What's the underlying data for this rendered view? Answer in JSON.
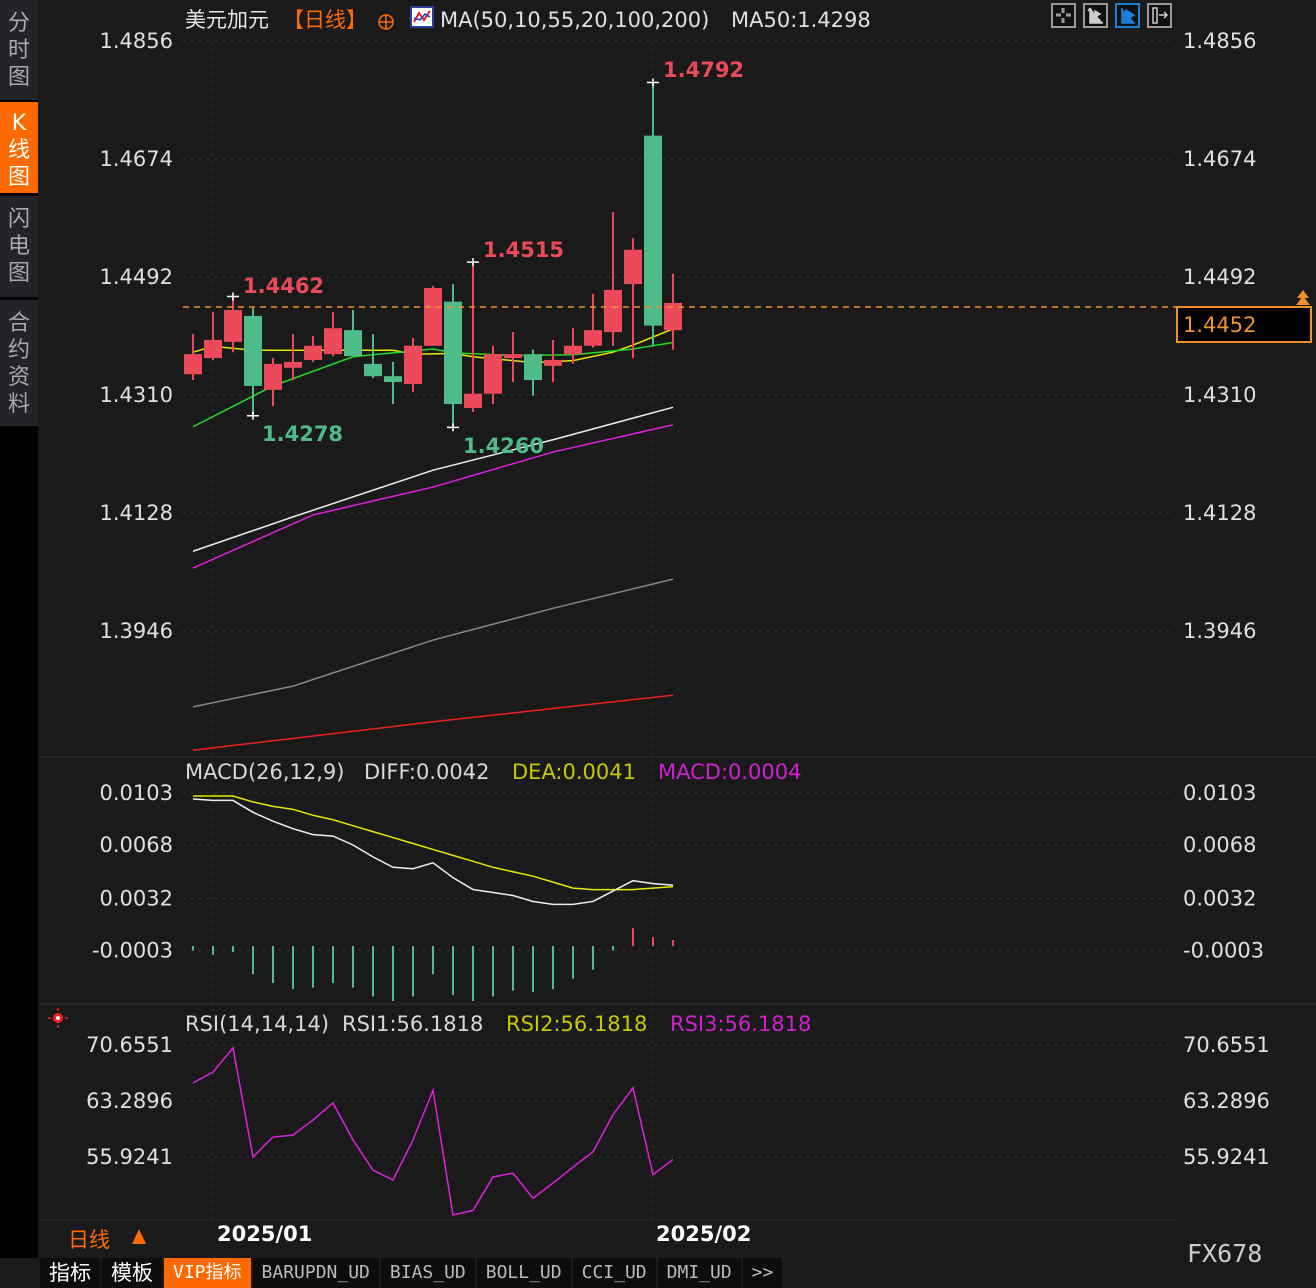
{
  "sidebar": {
    "tabs": [
      {
        "label": "分时图"
      },
      {
        "label": "K线图",
        "k": "K",
        "rest": "线图"
      },
      {
        "label": "闪电图"
      },
      {
        "label": "合约资料"
      }
    ]
  },
  "header": {
    "symbol": "美元加元",
    "period": "【日线】",
    "ma_params": "MA(50,10,55,20,100,200)",
    "ma50": "MA50:1.4298"
  },
  "toolbar": {
    "icons": [
      "crosshair-icon",
      "range-icon",
      "play-chart-icon",
      "scroll-right-icon"
    ],
    "active": 2
  },
  "price_axis": {
    "ticks": [
      "1.4856",
      "1.4674",
      "1.4492",
      "1.4310",
      "1.4128",
      "1.3946"
    ],
    "values": [
      1.4856,
      1.4674,
      1.4492,
      1.431,
      1.4128,
      1.3946
    ]
  },
  "current_price": "1.4452",
  "annotations": {
    "high": "1.4792",
    "high2": "1.4515",
    "high3": "1.4462",
    "low1": "1.4278",
    "low2": "1.4260"
  },
  "macd": {
    "title": "MACD(26,12,9)",
    "diff": "DIFF:0.0042",
    "dea": "DEA:0.0041",
    "macd": "MACD:0.0004",
    "ticks": [
      "0.0103",
      "0.0068",
      "0.0032",
      "-0.0003"
    ]
  },
  "rsi": {
    "title": "RSI(14,14,14)",
    "rsi1": "RSI1:56.1818",
    "rsi2": "RSI2:56.1818",
    "rsi3": "RSI3:56.1818",
    "ticks": [
      "70.6551",
      "63.2896",
      "55.9241"
    ]
  },
  "date_axis": {
    "period": "日线",
    "labels": [
      "2025/01",
      "2025/02"
    ]
  },
  "watermark": "FX678",
  "bottom_tabs": [
    {
      "label": "指标",
      "cn": true
    },
    {
      "label": "模板",
      "cn": true
    },
    {
      "label": "VIP指标",
      "active": true
    },
    {
      "label": "BARUPDN_UD"
    },
    {
      "label": "BIAS_UD"
    },
    {
      "label": "BOLL_UD"
    },
    {
      "label": "CCI_UD"
    },
    {
      "label": "DMI_UD"
    },
    {
      "label": ">>"
    }
  ],
  "colors": {
    "up": "#eb4a5a",
    "down": "#4fbb88",
    "accent": "#ff6a00",
    "bg": "#1a1a1a"
  },
  "chart_data": {
    "type": "candlestick",
    "ohlc": [
      [
        1.4342,
        1.4404,
        1.4333,
        1.4373
      ],
      [
        1.4367,
        1.4438,
        1.4364,
        1.4395
      ],
      [
        1.4392,
        1.4462,
        1.4376,
        1.4441
      ],
      [
        1.4432,
        1.4444,
        1.4278,
        1.4324
      ],
      [
        1.4318,
        1.4367,
        1.4293,
        1.4358
      ],
      [
        1.4352,
        1.4404,
        1.4333,
        1.4361
      ],
      [
        1.4364,
        1.4401,
        1.4361,
        1.4386
      ],
      [
        1.4373,
        1.4438,
        1.437,
        1.4413
      ],
      [
        1.441,
        1.4441,
        1.437,
        1.437
      ],
      [
        1.4358,
        1.4404,
        1.4336,
        1.4339
      ],
      [
        1.4339,
        1.4361,
        1.4296,
        1.433
      ],
      [
        1.4327,
        1.4398,
        1.4315,
        1.4386
      ],
      [
        1.4386,
        1.4478,
        1.4386,
        1.4475
      ],
      [
        1.4454,
        1.4481,
        1.426,
        1.4296
      ],
      [
        1.429,
        1.4515,
        1.4284,
        1.4312
      ],
      [
        1.4312,
        1.4386,
        1.4296,
        1.4373
      ],
      [
        1.4367,
        1.4407,
        1.433,
        1.4373
      ],
      [
        1.4373,
        1.438,
        1.4309,
        1.4333
      ],
      [
        1.4355,
        1.4395,
        1.433,
        1.4364
      ],
      [
        1.4373,
        1.4413,
        1.4358,
        1.4386
      ],
      [
        1.4386,
        1.4466,
        1.4383,
        1.441
      ],
      [
        1.4407,
        1.4592,
        1.4386,
        1.4472
      ],
      [
        1.4481,
        1.4552,
        1.4367,
        1.4534
      ],
      [
        1.471,
        1.4792,
        1.4386,
        1.4417
      ],
      [
        1.441,
        1.4497,
        1.438,
        1.4452
      ]
    ],
    "ma_lines": [
      {
        "color": "#e8e800",
        "points": [
          [
            0,
            1.4376
          ],
          [
            1,
            1.4385
          ],
          [
            3,
            1.4379
          ],
          [
            10,
            1.4379
          ],
          [
            11,
            1.4373
          ],
          [
            13,
            1.4374
          ],
          [
            14,
            1.4369
          ],
          [
            17,
            1.436
          ],
          [
            19,
            1.4363
          ],
          [
            21,
            1.4376
          ],
          [
            22,
            1.4387
          ],
          [
            24,
            1.4412
          ]
        ]
      },
      {
        "color": "#22dd22",
        "points": [
          [
            0,
            1.4261
          ],
          [
            4,
            1.4324
          ],
          [
            8,
            1.4369
          ],
          [
            10,
            1.4375
          ],
          [
            12,
            1.4381
          ],
          [
            13,
            1.4375
          ],
          [
            16,
            1.4371
          ],
          [
            19,
            1.4372
          ],
          [
            22,
            1.4381
          ],
          [
            24,
            1.4391
          ]
        ]
      },
      {
        "color": "#eeeeee",
        "points": [
          [
            0,
            1.4069
          ],
          [
            5,
            1.4122
          ],
          [
            12,
            1.4194
          ],
          [
            18,
            1.4241
          ],
          [
            24,
            1.4291
          ]
        ]
      },
      {
        "color": "#e020e0",
        "points": [
          [
            0,
            1.4043
          ],
          [
            6,
            1.4125
          ],
          [
            12,
            1.4168
          ],
          [
            18,
            1.4222
          ],
          [
            24,
            1.4264
          ]
        ]
      },
      {
        "color": "#888888",
        "points": [
          [
            0,
            1.3829
          ],
          [
            5,
            1.3861
          ],
          [
            12,
            1.3932
          ],
          [
            18,
            1.3981
          ],
          [
            24,
            1.4026
          ]
        ]
      },
      {
        "color": "#ee2222",
        "points": [
          [
            0,
            1.3762
          ],
          [
            12,
            1.3806
          ],
          [
            24,
            1.3847
          ]
        ]
      }
    ],
    "macd_diff": [
      0.0099,
      0.0098,
      0.0098,
      0.009,
      0.0084,
      0.0079,
      0.0075,
      0.0074,
      0.0068,
      0.006,
      0.0053,
      0.0052,
      0.0056,
      0.0046,
      0.0038,
      0.0036,
      0.0034,
      0.003,
      0.0028,
      0.0028,
      0.003,
      0.0037,
      0.0044,
      0.0042,
      0.0041
    ],
    "macd_dea": [
      0.0101,
      0.0101,
      0.0101,
      0.0097,
      0.0094,
      0.0092,
      0.0088,
      0.0085,
      0.0081,
      0.0077,
      0.0073,
      0.0069,
      0.0065,
      0.0061,
      0.0057,
      0.0053,
      0.005,
      0.0047,
      0.0043,
      0.0039,
      0.0038,
      0.0038,
      0.0038,
      0.0039,
      0.004
    ],
    "macd_hist": [
      -0.0003,
      -0.0006,
      -0.0004,
      -0.0019,
      -0.0025,
      -0.0029,
      -0.0028,
      -0.0025,
      -0.0028,
      -0.0034,
      -0.0037,
      -0.0034,
      -0.0019,
      -0.0033,
      -0.0037,
      -0.0034,
      -0.003,
      -0.0031,
      -0.0029,
      -0.0022,
      -0.0016,
      -0.0003,
      0.0012,
      0.0006,
      0.0004
    ],
    "rsi": [
      65.66,
      67.1,
      70.26,
      55.92,
      58.55,
      58.8,
      60.8,
      63.03,
      58.16,
      54.2,
      52.9,
      58.16,
      64.7,
      48.3,
      48.9,
      53.3,
      53.8,
      50.5,
      52.5,
      54.6,
      56.6,
      61.5,
      65.0,
      53.6,
      55.6
    ]
  }
}
